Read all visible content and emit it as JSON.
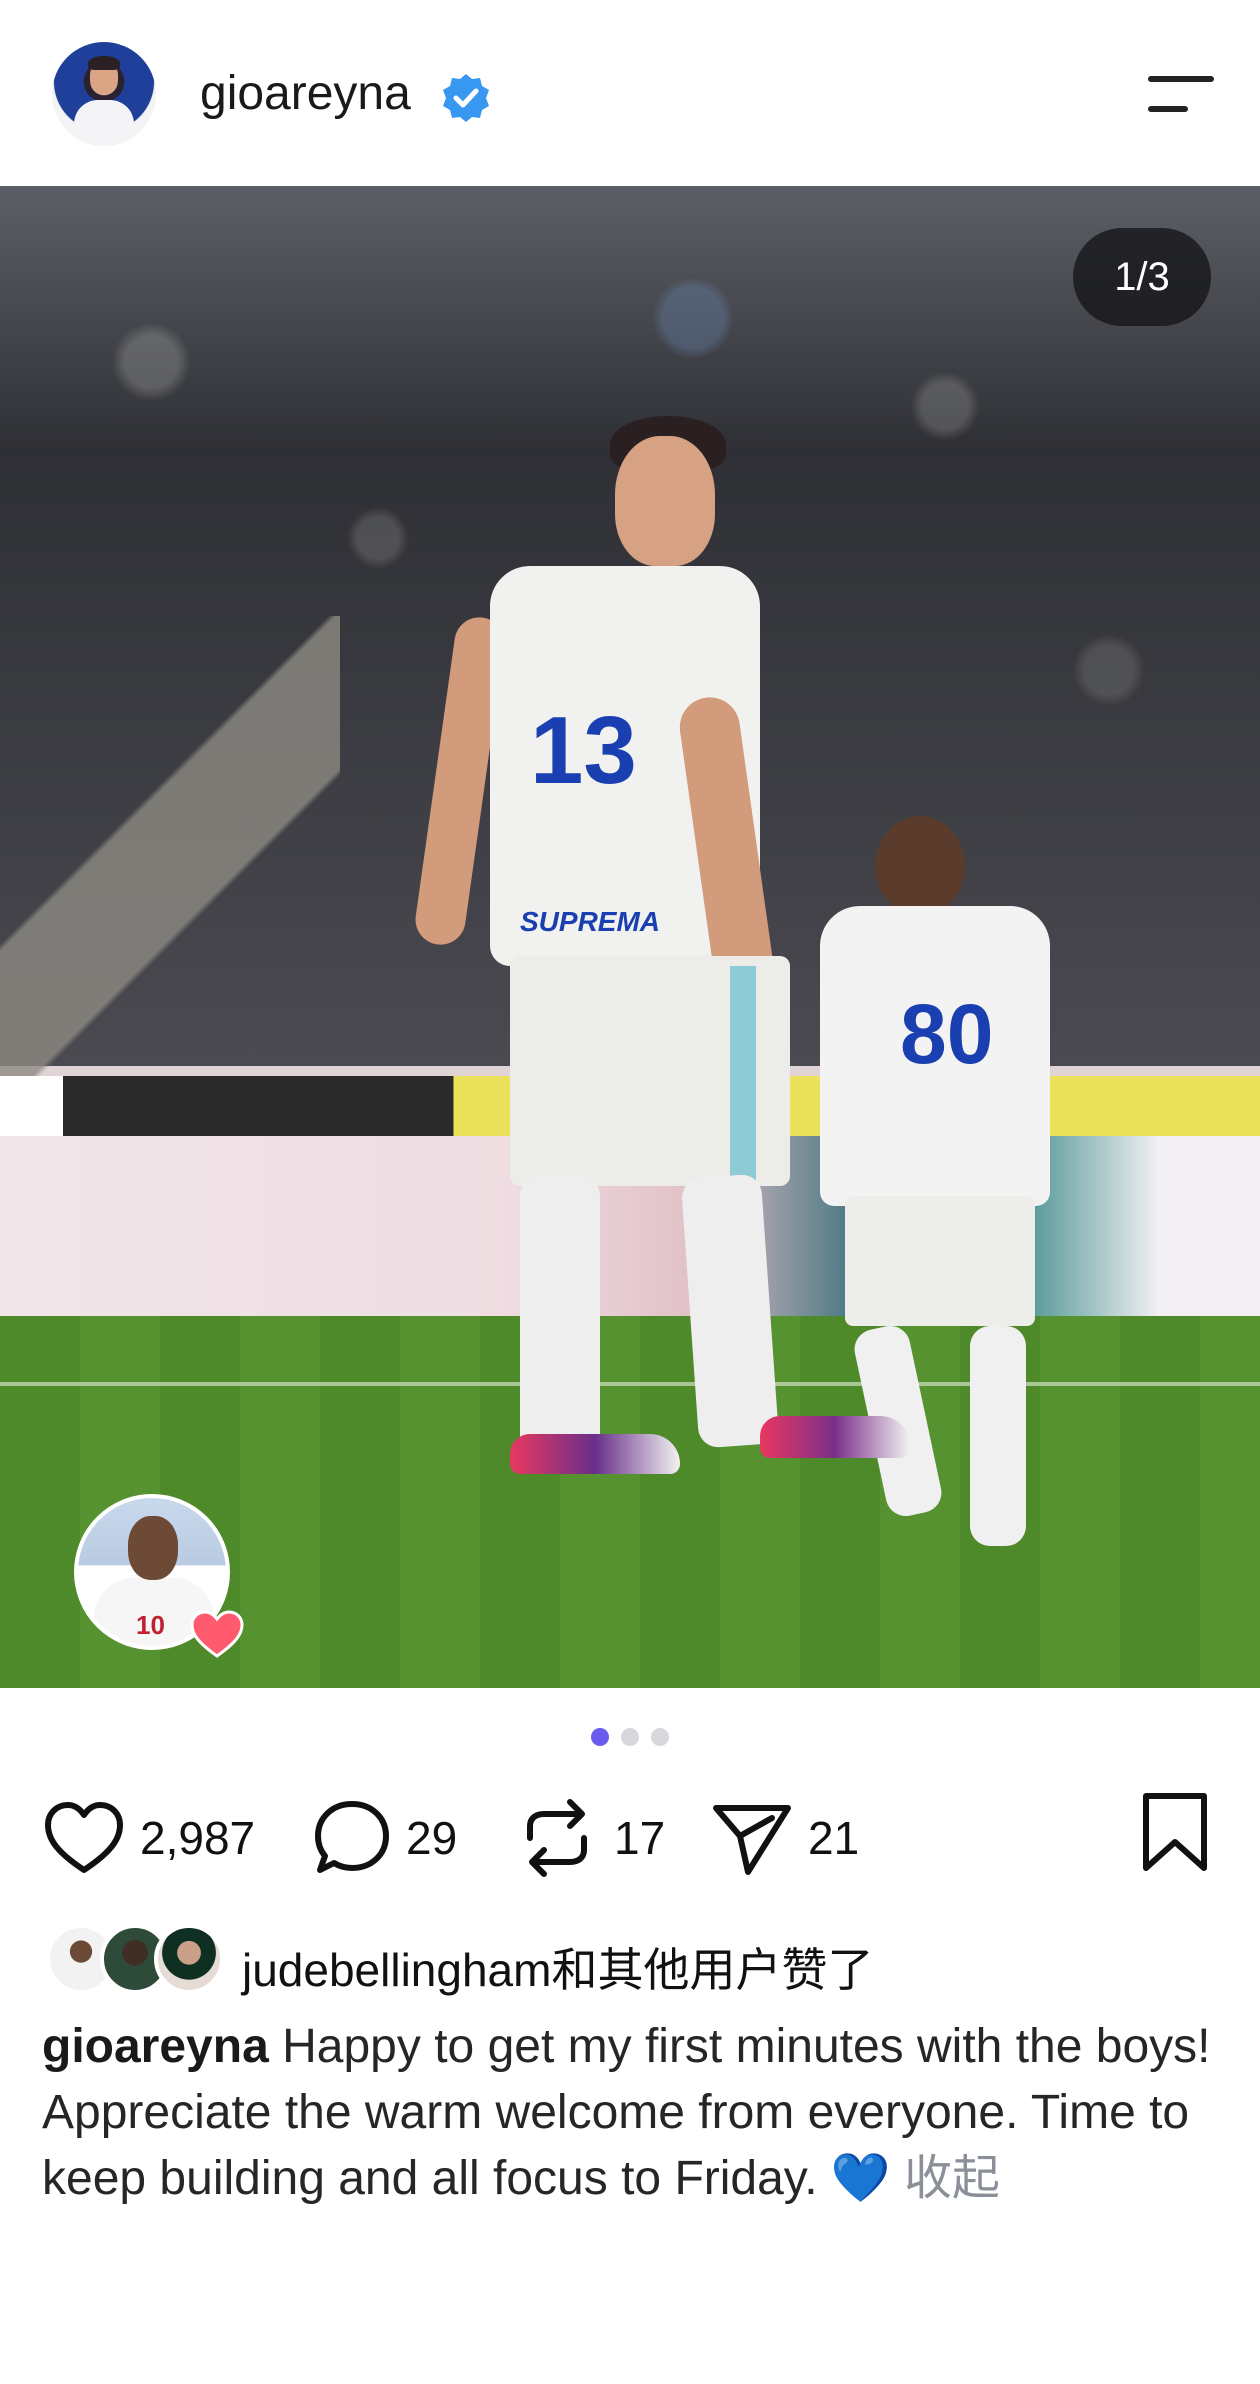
{
  "header": {
    "username": "gioareyna",
    "verified": true,
    "avatar_icon": "profile-avatar",
    "menu_icon": "menu-icon"
  },
  "post": {
    "slide_counter": "1/3",
    "slides_total": 3,
    "active_slide": 1,
    "player_number_main": "13",
    "player_number_back": "80",
    "sponsor_text": "SUPREMA",
    "liker_shirt_number": "10"
  },
  "actions": {
    "likes": "2,987",
    "comments": "29",
    "reposts": "17",
    "shares": "21"
  },
  "liked_by": {
    "text": "judebellingham和其他用户赞了"
  },
  "caption": {
    "username": "gioareyna",
    "text": "Happy to get my first minutes with the boys! Appreciate the warm welcome from everyone. Time to keep building and all focus to Friday. ",
    "emoji": "💙",
    "collapse_label": "收起"
  },
  "colors": {
    "accent": "#6b5cf0",
    "verified": "#3897f0",
    "heart_badge": "#ff5a6e"
  }
}
